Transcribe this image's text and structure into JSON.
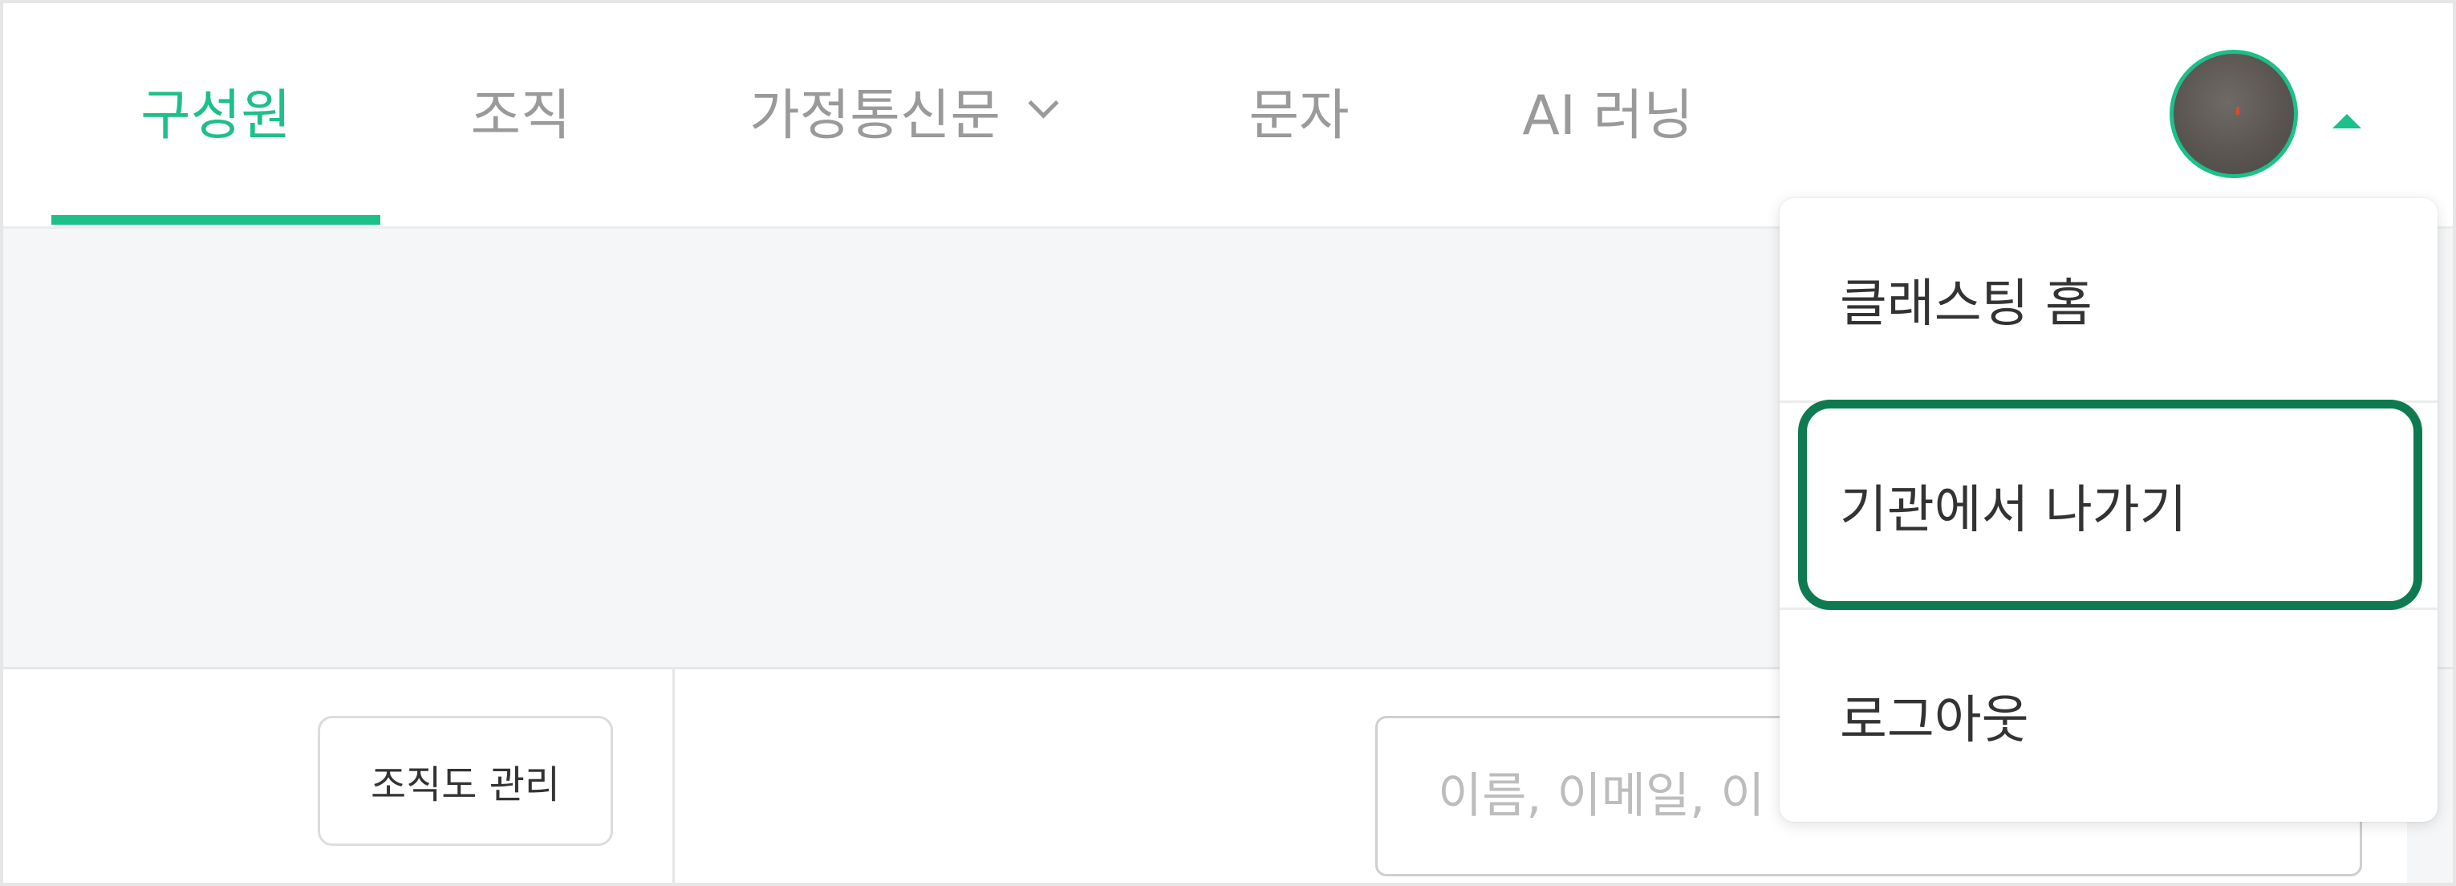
{
  "nav": {
    "tabs": [
      {
        "label": "구성원",
        "active": true
      },
      {
        "label": "조직",
        "active": false
      },
      {
        "label": "가정통신문",
        "active": false,
        "has_dropdown": true
      },
      {
        "label": "문자",
        "active": false
      },
      {
        "label": "AI 러닝",
        "active": false
      }
    ],
    "avatar_icon": "user-avatar",
    "menu_toggle_icon": "caret-up-icon"
  },
  "toolbar": {
    "org_chart_button": "조직도 관리",
    "search_placeholder": "이름, 이메일, 이",
    "search_value": ""
  },
  "user_menu": {
    "items": [
      {
        "label": "클래스팅 홈"
      },
      {
        "label": "기관에서 나가기",
        "highlighted": true
      },
      {
        "label": "로그아웃"
      }
    ]
  },
  "colors": {
    "accent": "#1cc089",
    "highlight_border": "#0e7a50",
    "tab_inactive": "#9a9a9a",
    "banner_bg": "#f5f6f8"
  }
}
